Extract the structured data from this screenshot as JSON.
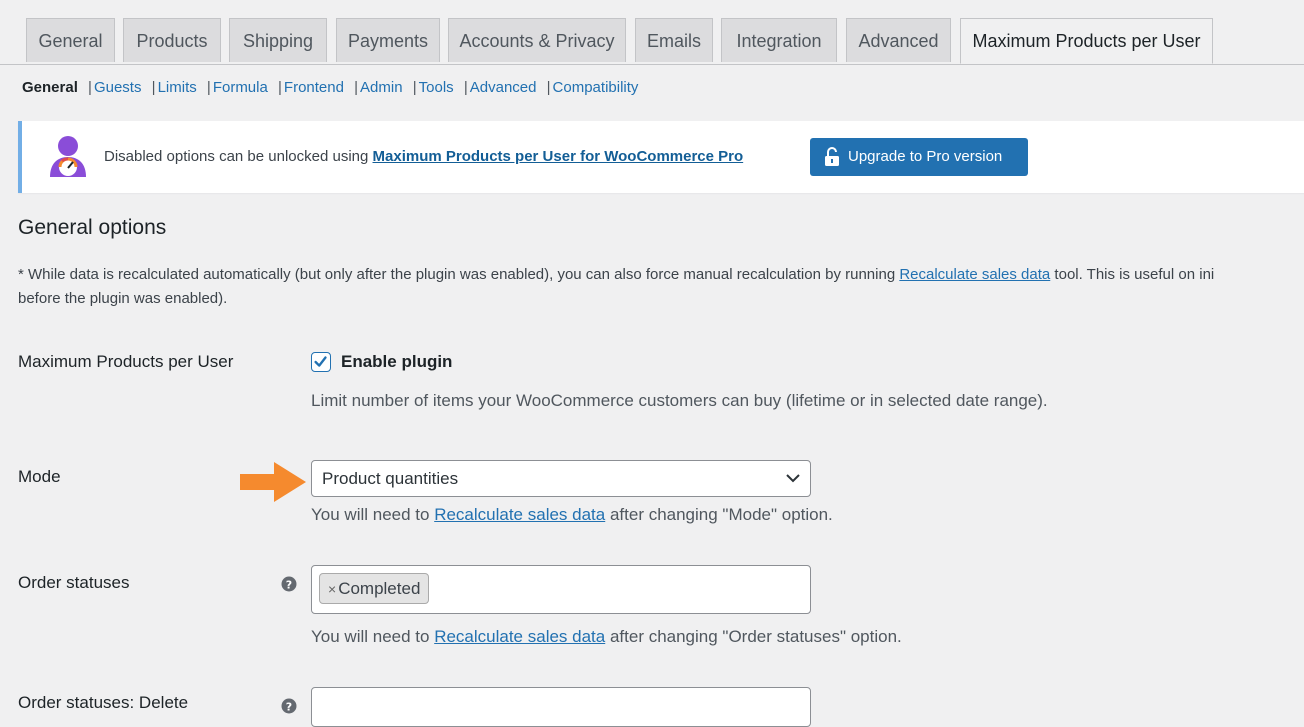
{
  "tabs": [
    "General",
    "Products",
    "Shipping",
    "Payments",
    "Accounts & Privacy",
    "Emails",
    "Integration",
    "Advanced",
    "Maximum Products per User"
  ],
  "subnav": {
    "current": "General",
    "links": [
      "Guests",
      "Limits",
      "Formula",
      "Frontend",
      "Admin",
      "Tools",
      "Advanced",
      "Compatibility"
    ],
    "separator": "|"
  },
  "notice": {
    "text": "Disabled options can be unlocked using ",
    "link": "Maximum Products per User for WooCommerce Pro",
    "button": "Upgrade to Pro version"
  },
  "section": {
    "title": "General options",
    "desc_prefix": "* While data is recalculated automatically (but only after the plugin was enabled), you can also force manual recalculation by running ",
    "desc_link": "Recalculate sales data",
    "desc_suffix": " tool. This is useful on ini",
    "desc_line2": "before the plugin was enabled)."
  },
  "fields": {
    "plugin": {
      "label": "Maximum Products per User",
      "checkbox_label": "Enable plugin",
      "checked": true,
      "description": "Limit number of items your WooCommerce customers can buy (lifetime or in selected date range)."
    },
    "mode": {
      "label": "Mode",
      "value": "Product quantities",
      "desc_prefix": "You will need to ",
      "desc_link": "Recalculate sales data",
      "desc_suffix": " after changing \"Mode\" option."
    },
    "order_statuses": {
      "label": "Order statuses",
      "chip_remove": "×",
      "chips": [
        "Completed"
      ],
      "desc_prefix": "You will need to ",
      "desc_link": "Recalculate sales data",
      "desc_suffix": " after changing \"Order statuses\" option."
    },
    "order_statuses_delete": {
      "label": "Order statuses: Delete"
    }
  },
  "colors": {
    "accent": "#2271b1",
    "arrow": "#f58a2e",
    "notice_border": "#72aee6",
    "logo_purple": "#8a4dd8"
  }
}
